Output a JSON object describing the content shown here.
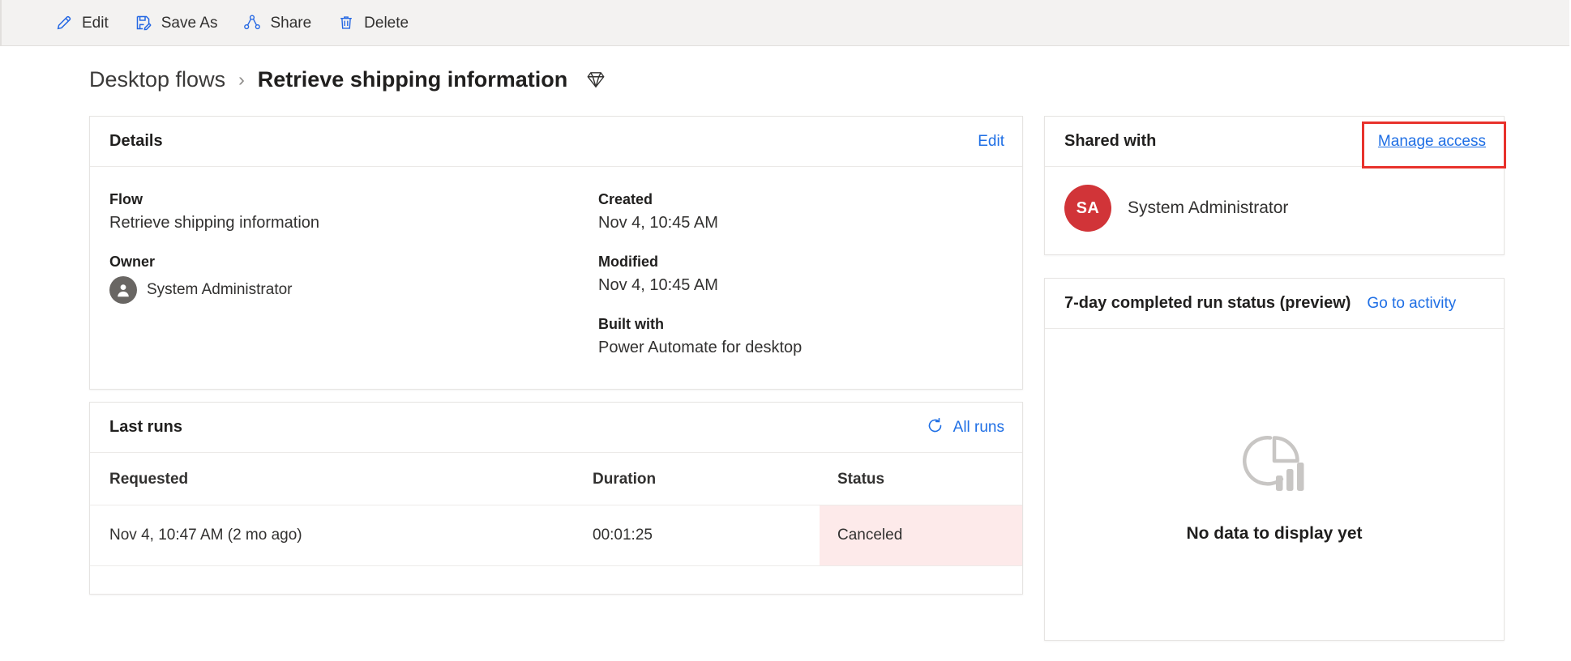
{
  "commandbar": {
    "items": [
      {
        "label": "Edit",
        "icon": "pencil-icon"
      },
      {
        "label": "Save As",
        "icon": "save-as-icon"
      },
      {
        "label": "Share",
        "icon": "share-icon"
      },
      {
        "label": "Delete",
        "icon": "trash-icon"
      }
    ]
  },
  "breadcrumb": {
    "root": "Desktop flows",
    "separator": "›",
    "current": "Retrieve shipping information",
    "badge_icon": "gem-icon"
  },
  "details": {
    "title": "Details",
    "edit_label": "Edit",
    "fields": {
      "flow_label": "Flow",
      "flow_value": "Retrieve shipping information",
      "owner_label": "Owner",
      "owner_value": "System Administrator",
      "created_label": "Created",
      "created_value": "Nov 4, 10:45 AM",
      "modified_label": "Modified",
      "modified_value": "Nov 4, 10:45 AM",
      "built_with_label": "Built with",
      "built_with_value": "Power Automate for desktop"
    }
  },
  "last_runs": {
    "title": "Last runs",
    "all_runs_label": "All runs",
    "refresh_icon": "refresh-icon",
    "columns": [
      "Requested",
      "Duration",
      "Status"
    ],
    "rows": [
      {
        "requested": "Nov 4, 10:47 AM (2 mo ago)",
        "duration": "00:01:25",
        "status": "Canceled",
        "status_bg": "#fdeaea"
      }
    ]
  },
  "shared_with": {
    "title": "Shared with",
    "manage_access_label": "Manage access",
    "people": [
      {
        "initials": "SA",
        "name": "System Administrator",
        "avatar_color": "#d13438"
      }
    ]
  },
  "run_status": {
    "title": "7-day completed run status (preview)",
    "link_label": "Go to activity",
    "empty_icon": "pie-bar-chart-icon",
    "empty_text": "No data to display yet"
  },
  "colors": {
    "accent_blue": "#1f6fe5",
    "icon_blue": "#2266e3",
    "highlight_red": "#e8322c",
    "avatar_red": "#d13438",
    "status_canceled_bg": "#fdeaea",
    "commandbar_bg": "#f3f2f1",
    "card_border": "#e6e4e2"
  }
}
